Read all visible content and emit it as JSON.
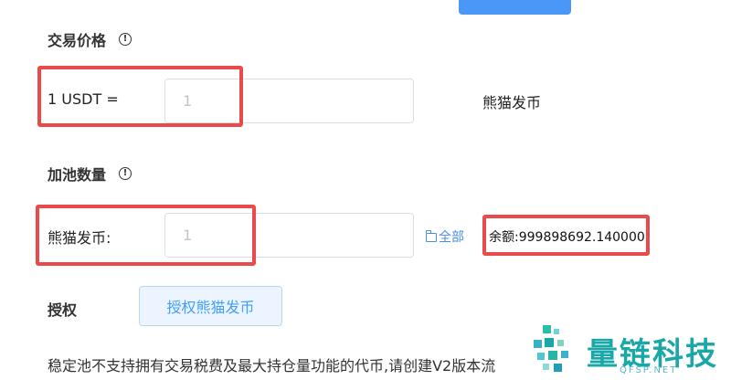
{
  "form": {
    "price_section_title": "交易价格",
    "price_row": {
      "label": "1 USDT =",
      "input_placeholder": "1",
      "unit": "熊猫发币"
    },
    "liquidity_section_title": "加池数量",
    "amount_row": {
      "label": "熊猫发币:",
      "input_placeholder": "1",
      "all_label": "全部",
      "balance_label": "余额:999898692.140000"
    },
    "authorize": {
      "label": "授权",
      "button_label": "授权熊猫发币"
    },
    "notice": "稳定池不支持拥有交易税费及最大持仓量功能的代币,请创建V2版本流"
  },
  "watermark": {
    "title": "量链科技",
    "subtitle": "QFSP.NET"
  },
  "colors": {
    "primary": "#409eff",
    "highlight_box": "#ea4a4a",
    "watermark": "#1aa7a7"
  }
}
